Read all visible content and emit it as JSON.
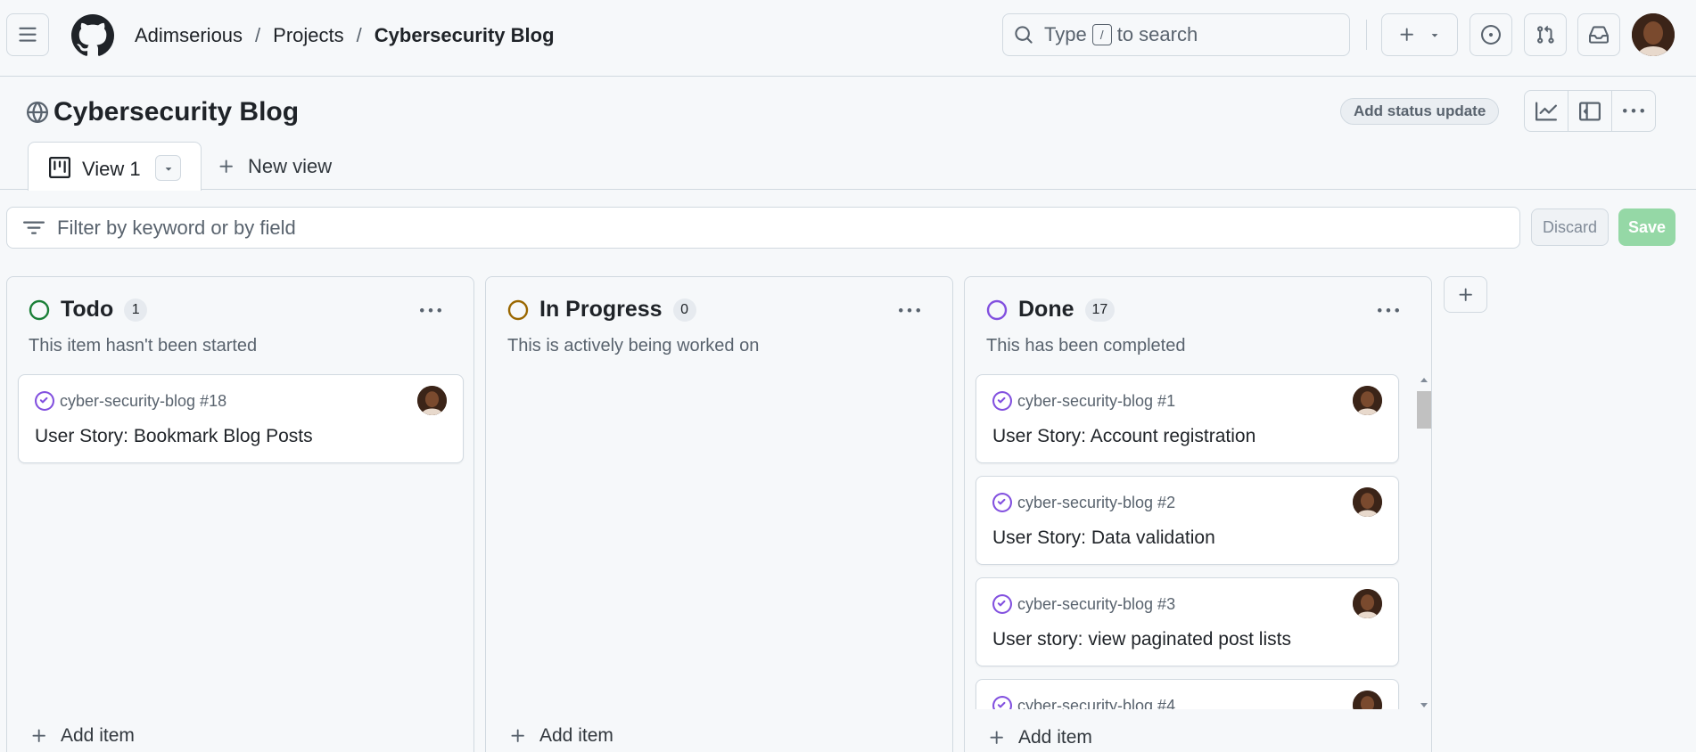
{
  "header": {
    "breadcrumbs": [
      "Adimserious",
      "Projects",
      "Cybersecurity Blog"
    ],
    "separator": "/",
    "search": {
      "before": "Type",
      "key": "/",
      "after": "to search"
    }
  },
  "project": {
    "title": "Cybersecurity Blog",
    "status_button": "Add status update"
  },
  "tabs": {
    "active": "View 1",
    "new_view": "New view"
  },
  "filter": {
    "placeholder": "Filter by keyword or by field",
    "discard": "Discard",
    "save": "Save"
  },
  "columns": [
    {
      "name": "Todo",
      "count": "1",
      "description": "This item hasn't been started",
      "status_color": "#1a7f37",
      "add_item": "Add item",
      "cards": [
        {
          "ref": "cyber-security-blog #18",
          "title": "User Story: Bookmark Blog Posts"
        }
      ]
    },
    {
      "name": "In Progress",
      "count": "0",
      "description": "This is actively being worked on",
      "status_color": "#9a6700",
      "add_item": "Add item",
      "cards": []
    },
    {
      "name": "Done",
      "count": "17",
      "description": "This has been completed",
      "status_color": "#8250df",
      "add_item": "Add item",
      "cards": [
        {
          "ref": "cyber-security-blog #1",
          "title": "User Story: Account registration"
        },
        {
          "ref": "cyber-security-blog #2",
          "title": "User Story: Data validation"
        },
        {
          "ref": "cyber-security-blog #3",
          "title": "User story: view paginated post lists"
        },
        {
          "ref": "cyber-security-blog #4",
          "title": ""
        }
      ]
    }
  ],
  "colors": {
    "accent_closed": "#8250df",
    "save_disabled": "#95d8a6",
    "border": "#d1d9e0",
    "muted_text": "#59636e"
  },
  "icons": {
    "menu": "hamburger-icon",
    "logo": "github-logo-icon",
    "search": "search-icon",
    "create": "plus-icon",
    "issues": "issue-opened-icon",
    "pulls": "git-pull-request-icon",
    "inbox": "inbox-icon",
    "globe": "globe-icon",
    "insights": "graph-icon",
    "sidepanel": "sidebar-icon",
    "more": "kebab-horizontal-icon",
    "board": "project-board-icon",
    "filter": "filter-icon",
    "closed": "issue-closed-icon"
  }
}
